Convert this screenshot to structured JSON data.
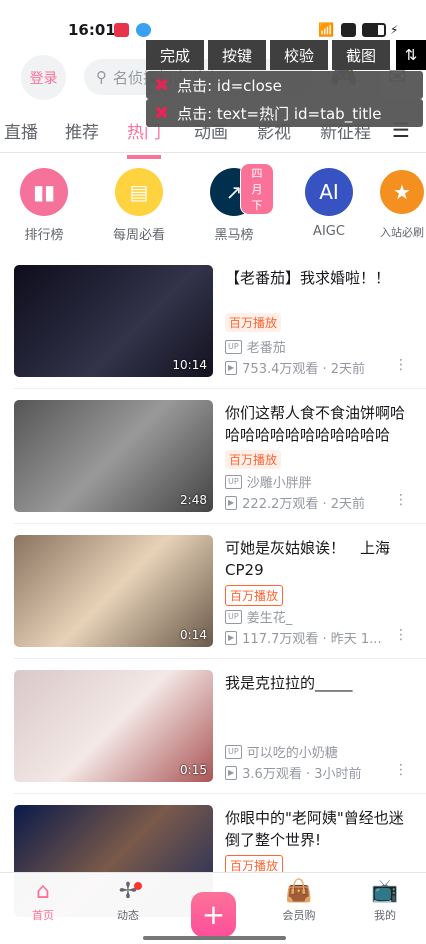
{
  "status": {
    "time": "16:01"
  },
  "header": {
    "login": "登录",
    "search_placeholder": "名侦探柯南 中邮"
  },
  "tabs": [
    "直播",
    "推荐",
    "热门",
    "动画",
    "影视",
    "新征程"
  ],
  "categories": [
    {
      "label": "排行榜",
      "color": "#f5739b"
    },
    {
      "label": "每周必看",
      "color": "#ffd23f"
    },
    {
      "label": "黑马榜",
      "color": "#00304d",
      "badge": "四月下"
    },
    {
      "label": "AIGC",
      "color": "#3653c1",
      "glyph": "AI"
    },
    {
      "label": "入站必刷",
      "color": "#f39020"
    }
  ],
  "videos": [
    {
      "title": "【老番茄】我求婚啦！！",
      "badge": "百万播放",
      "up": "老番茄",
      "meta": "753.4万观看 · 2天前",
      "duration": "10:14",
      "bg": "linear-gradient(135deg,#0d0d1c,#33334a 60%,#12121f)"
    },
    {
      "title": "你们这帮人食不食油饼啊哈哈哈哈哈哈哈哈哈哈哈哈",
      "badge": "百万播放",
      "up": "沙雕小胖胖",
      "meta": "222.2万观看 · 2天前",
      "duration": "2:48",
      "bg": "linear-gradient(135deg,#555,#999 50%,#444)"
    },
    {
      "title": "可她是灰姑娘诶！　上海CP29",
      "badge": "百万播放",
      "up": "姜生花_",
      "meta": "117.7万观看 · 昨天 1...",
      "duration": "0:14",
      "bg": "linear-gradient(135deg,#8a7360,#e7d2b8 50%,#6a5a4a)"
    },
    {
      "title": "我是克拉拉的_____",
      "badge": "",
      "up": "可以吃的小奶糖",
      "meta": "3.6万观看 · 3小时前",
      "duration": "0:15",
      "bg": "linear-gradient(135deg,#d9c8c8,#f3e8e6 50%,#a55)"
    },
    {
      "title": "你眼中的\"老阿姨\"曾经也迷倒了整个世界!",
      "badge": "百万播放",
      "up": "",
      "meta": "",
      "duration": "",
      "bg": "linear-gradient(135deg,#0a1a4a,#7a5a4a 50%,#1a2a5a)"
    }
  ],
  "overlay": {
    "buttons": [
      "完成",
      "按键",
      "校验",
      "截图",
      "⇅"
    ],
    "logs": [
      "点击: id=close",
      "点击: text=热门 id=tab_title"
    ]
  },
  "nav": {
    "items": [
      "首页",
      "动态",
      "会员购",
      "我的"
    ]
  }
}
